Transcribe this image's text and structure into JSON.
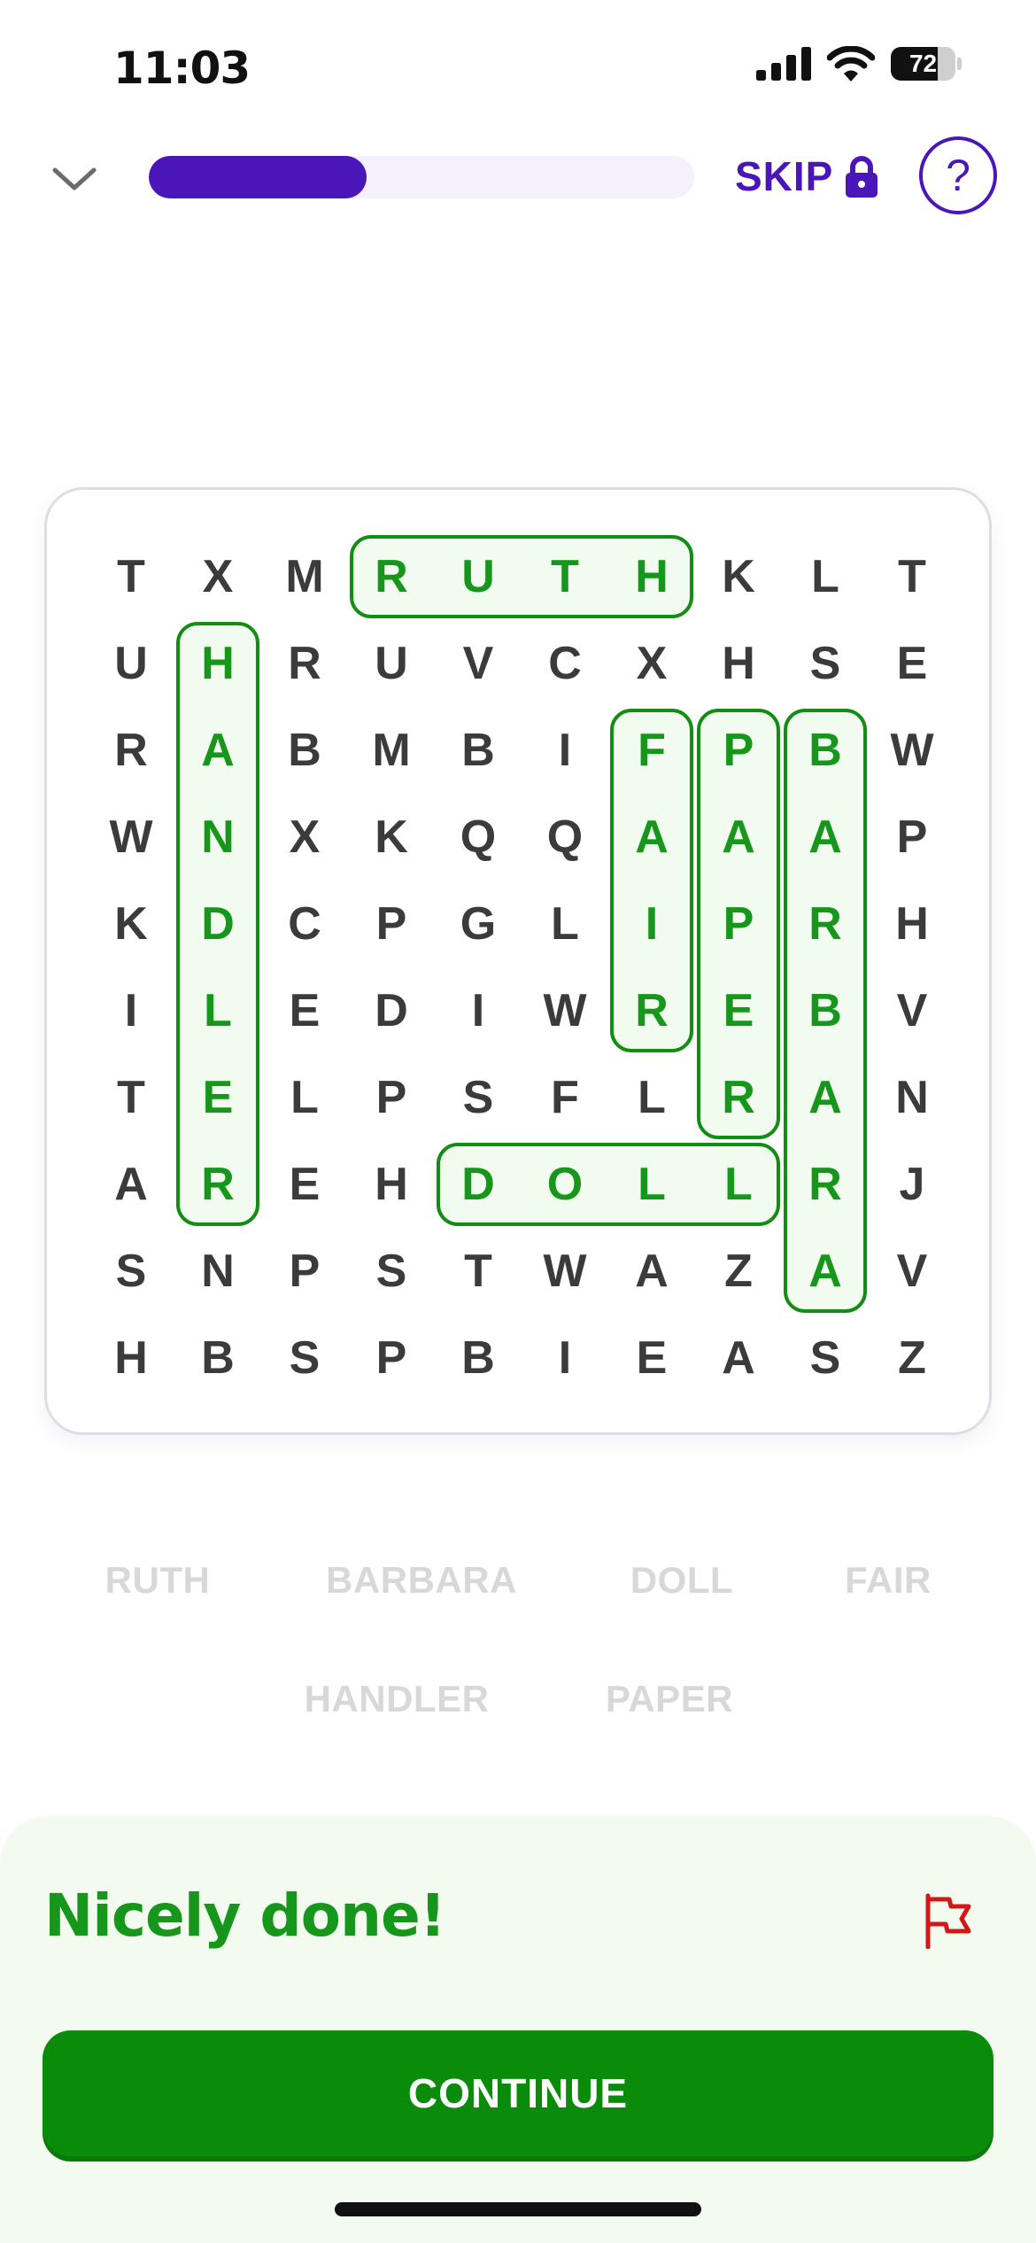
{
  "status_bar": {
    "time": "11:03",
    "battery_level": "72",
    "battery_fraction": 0.72
  },
  "nav": {
    "progress_fraction": 0.4,
    "skip_label": "SKIP",
    "help_label": "?"
  },
  "grid": [
    [
      "T",
      "X",
      "M",
      "R",
      "U",
      "T",
      "H",
      "K",
      "L",
      "T"
    ],
    [
      "U",
      "H",
      "R",
      "U",
      "V",
      "C",
      "X",
      "H",
      "S",
      "E"
    ],
    [
      "R",
      "A",
      "B",
      "M",
      "B",
      "I",
      "F",
      "P",
      "B",
      "W"
    ],
    [
      "W",
      "N",
      "X",
      "K",
      "Q",
      "Q",
      "A",
      "A",
      "A",
      "P"
    ],
    [
      "K",
      "D",
      "C",
      "P",
      "G",
      "L",
      "I",
      "P",
      "R",
      "H"
    ],
    [
      "I",
      "L",
      "E",
      "D",
      "I",
      "W",
      "R",
      "E",
      "B",
      "V"
    ],
    [
      "T",
      "E",
      "L",
      "P",
      "S",
      "F",
      "L",
      "R",
      "A",
      "N"
    ],
    [
      "A",
      "R",
      "E",
      "H",
      "D",
      "O",
      "L",
      "L",
      "R",
      "J"
    ],
    [
      "S",
      "N",
      "P",
      "S",
      "T",
      "W",
      "A",
      "Z",
      "A",
      "V"
    ],
    [
      "H",
      "B",
      "S",
      "P",
      "B",
      "I",
      "E",
      "A",
      "S",
      "Z"
    ]
  ],
  "found_words": [
    {
      "word": "RUTH",
      "start": [
        0,
        3
      ],
      "end": [
        0,
        6
      ]
    },
    {
      "word": "HANDLER",
      "start": [
        1,
        1
      ],
      "end": [
        7,
        1
      ]
    },
    {
      "word": "FAIR",
      "start": [
        2,
        6
      ],
      "end": [
        5,
        6
      ]
    },
    {
      "word": "PAPER",
      "start": [
        2,
        7
      ],
      "end": [
        6,
        7
      ]
    },
    {
      "word": "BARBARA",
      "start": [
        2,
        8
      ],
      "end": [
        8,
        8
      ]
    },
    {
      "word": "DOLL",
      "start": [
        7,
        4
      ],
      "end": [
        7,
        7
      ]
    }
  ],
  "word_bank": [
    [
      "RUTH",
      "BARBARA",
      "DOLL",
      "FAIR"
    ],
    [
      "HANDLER",
      "PAPER"
    ]
  ],
  "feedback": {
    "message": "Nicely done!",
    "continue_label": "CONTINUE"
  },
  "colors": {
    "accent_purple": "#4a16b9",
    "success_green": "#16961a",
    "button_green": "#0a8c0a",
    "flag_red": "#d01818",
    "muted_word": "#d8d8d8"
  },
  "icons": {
    "collapse": "chevron-down-icon",
    "lock": "lock-icon",
    "help": "question-icon",
    "flag": "flag-icon",
    "signal": "signal-icon",
    "wifi": "wifi-icon",
    "battery": "battery-icon"
  }
}
